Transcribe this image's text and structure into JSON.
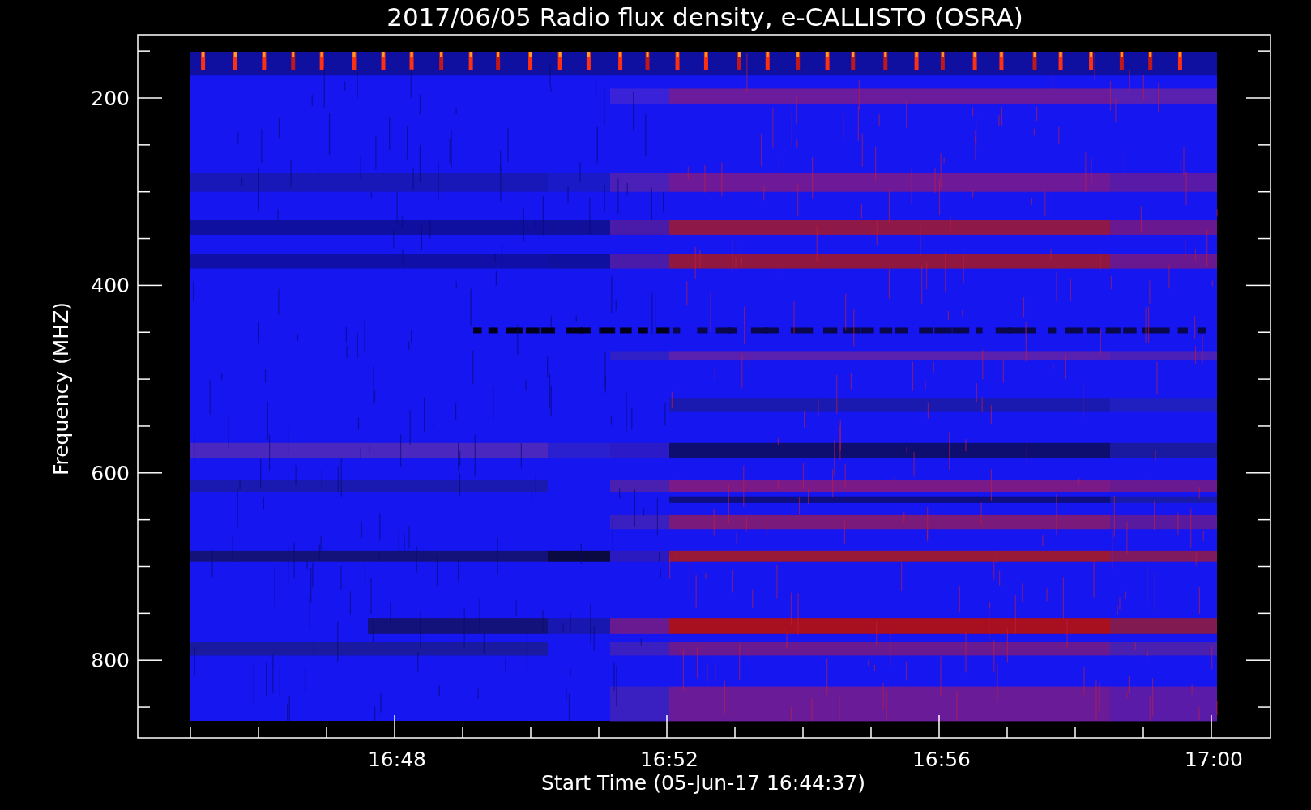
{
  "title": "2017/06/05  Radio flux density, e-CALLISTO (OSRA)",
  "y_axis": {
    "label": "Frequency (MHZ)",
    "ticks": [
      "200",
      "400",
      "600",
      "800"
    ]
  },
  "x_axis": {
    "label": "Start Time (05-Jun-17 16:44:37)",
    "ticks": [
      "16:48",
      "16:52",
      "16:56",
      "17:00"
    ]
  }
}
